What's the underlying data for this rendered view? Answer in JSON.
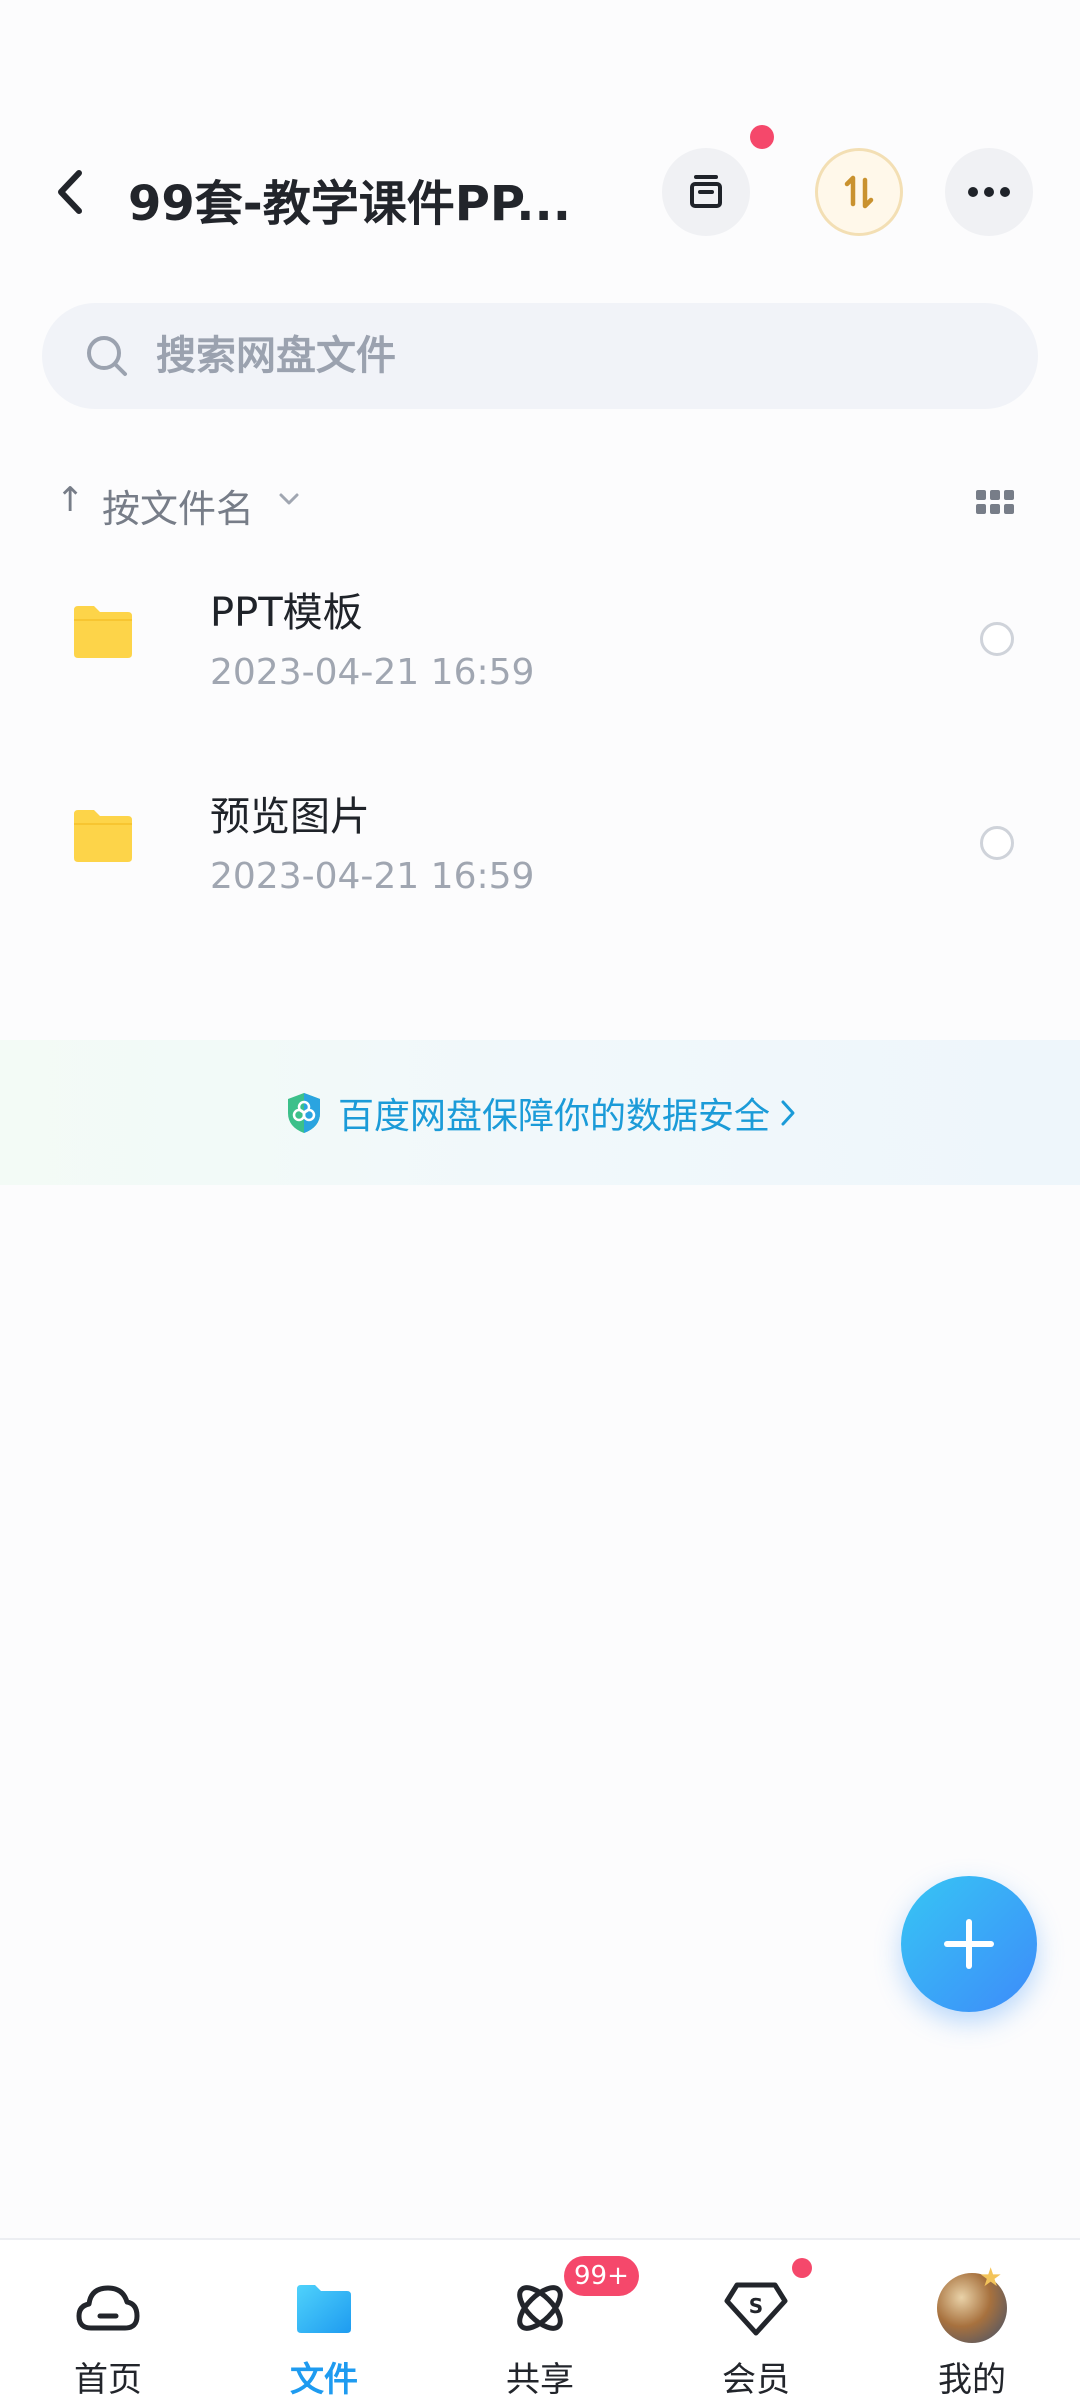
{
  "header": {
    "title": "99套-教学课件PP...",
    "back_icon": "chevron-left-icon",
    "actions": [
      {
        "name": "archive",
        "icon": "archive-box-icon"
      },
      {
        "name": "transfer",
        "icon": "transfer-icon"
      },
      {
        "name": "more",
        "icon": "more-dots-icon"
      }
    ]
  },
  "search": {
    "placeholder": "搜索网盘文件",
    "value": ""
  },
  "sort": {
    "label": "按文件名",
    "direction": "↑"
  },
  "files": [
    {
      "name": "PPT模板",
      "time": "2023-04-21  16:59",
      "type": "folder"
    },
    {
      "name": "预览图片",
      "time": "2023-04-21  16:59",
      "type": "folder"
    }
  ],
  "banner": {
    "text": "百度网盘保障你的数据安全"
  },
  "bottom_nav": [
    {
      "label": "首页",
      "icon": "cloud-icon",
      "active": false
    },
    {
      "label": "文件",
      "icon": "folder-icon",
      "active": true
    },
    {
      "label": "共享",
      "icon": "share-orbit-icon",
      "active": false,
      "badge": "99+"
    },
    {
      "label": "会员",
      "icon": "vip-diamond-icon",
      "active": false,
      "dot": true
    },
    {
      "label": "我的",
      "icon": "avatar-icon",
      "active": false
    }
  ],
  "colors": {
    "accent": "#1e9bf0",
    "folder": "#fdd449",
    "badge": "#f5486b",
    "banner_text": "#1b9bd8"
  }
}
